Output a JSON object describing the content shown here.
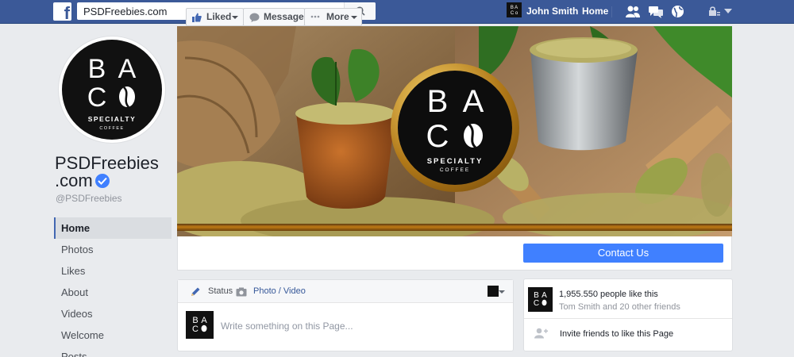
{
  "topbar": {
    "logo": "f",
    "search_value": "PSDFreebies.com",
    "user_name": "John Smith",
    "home_label": "Home",
    "icons": [
      "friends-icon",
      "messages-icon",
      "globe-icon",
      "lock-icon",
      "caret-down-icon"
    ]
  },
  "page": {
    "name_line1": "PSDFreebies",
    "name_line2": ".com",
    "handle": "@PSDFreebies"
  },
  "logo_text": {
    "letters": [
      "B",
      "A",
      "C"
    ],
    "line1": "SPECIALTY",
    "line2": "COFFEE"
  },
  "nav": {
    "items": [
      {
        "label": "Home",
        "active": true
      },
      {
        "label": "Photos",
        "active": false
      },
      {
        "label": "Likes",
        "active": false
      },
      {
        "label": "About",
        "active": false
      },
      {
        "label": "Videos",
        "active": false
      },
      {
        "label": "Welcome",
        "active": false
      },
      {
        "label": "Posts",
        "active": false
      }
    ]
  },
  "actions": {
    "liked_label": "Liked",
    "message_label": "Message",
    "more_label": "More",
    "contact_label": "Contact Us"
  },
  "composer": {
    "status_label": "Status",
    "photo_label": "Photo / Video",
    "placeholder": "Write something on this Page..."
  },
  "likes_box": {
    "count_text": "1,955.550 people like this",
    "friends_text": "Tom Smith and 20 other friends",
    "invite_text": "Invite friends to like this Page"
  },
  "colors": {
    "brand": "#3b5998",
    "accent": "#4080ff",
    "background": "#e9ebee"
  }
}
